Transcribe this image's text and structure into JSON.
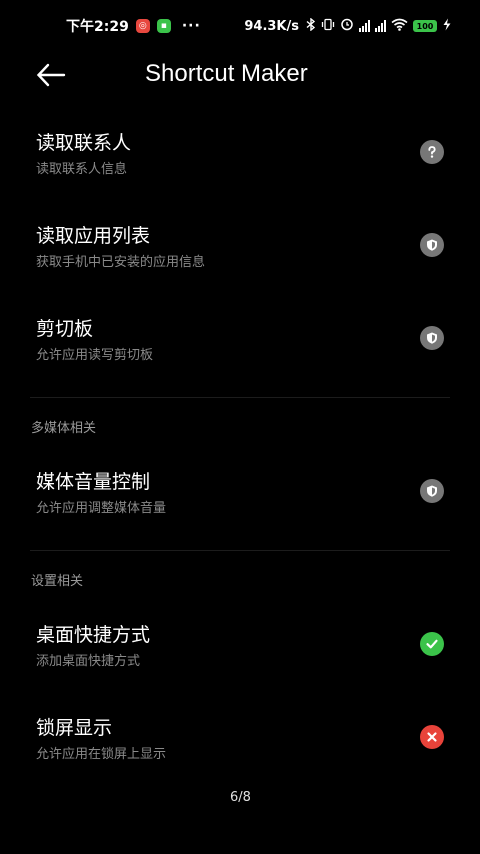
{
  "status_bar": {
    "time": "下午2:29",
    "dots": "···",
    "net_speed": "94.3K/s",
    "battery": "100"
  },
  "app_bar": {
    "title": "Shortcut Maker"
  },
  "sections": [
    {
      "items": [
        {
          "title": "读取联系人",
          "subtitle": "读取联系人信息",
          "status": "question"
        },
        {
          "title": "读取应用列表",
          "subtitle": "获取手机中已安装的应用信息",
          "status": "shield"
        },
        {
          "title": "剪切板",
          "subtitle": "允许应用读写剪切板",
          "status": "shield"
        }
      ]
    },
    {
      "header": "多媒体相关",
      "items": [
        {
          "title": "媒体音量控制",
          "subtitle": "允许应用调整媒体音量",
          "status": "shield"
        }
      ]
    },
    {
      "header": "设置相关",
      "items": [
        {
          "title": "桌面快捷方式",
          "subtitle": "添加桌面快捷方式",
          "status": "granted"
        },
        {
          "title": "锁屏显示",
          "subtitle": "允许应用在锁屏上显示",
          "status": "denied"
        }
      ]
    }
  ],
  "page_indicator": "6/8",
  "colors": {
    "background": "#000000",
    "granted": "#3bc34a",
    "denied": "#e8433a",
    "neutral": "#777777"
  }
}
